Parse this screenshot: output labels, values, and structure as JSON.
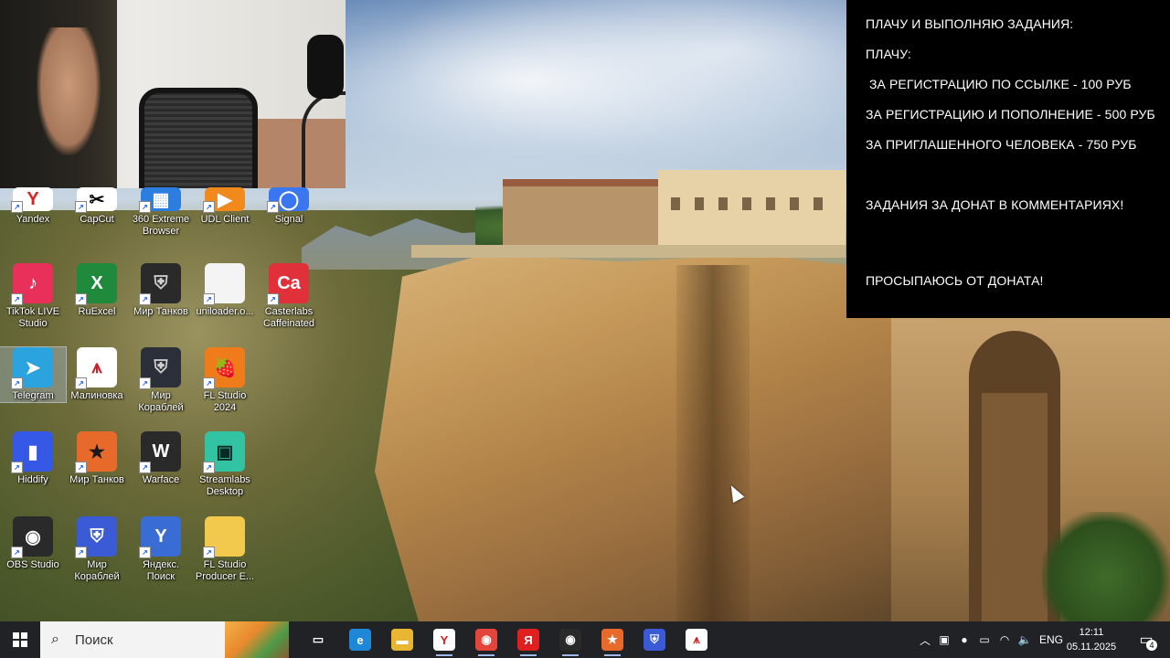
{
  "panel": {
    "lines": [
      "ПЛАЧУ И ВЫПОЛНЯЮ ЗАДАНИЯ:",
      "ПЛАЧУ:",
      " ЗА РЕГИСТРАЦИЮ ПО ССЫЛКЕ - 100 РУБ",
      "ЗА РЕГИСТРАЦИЮ И ПОПОЛНЕНИЕ - 500 РУБ",
      "ЗА ПРИГЛАШЕННОГО ЧЕЛОВЕКА - 750 РУБ",
      "ЗАДАНИЯ ЗА ДОНАТ В КОММЕНТАРИЯХ!",
      "ПРОСЫПАЮСЬ ОТ ДОНАТА!"
    ]
  },
  "desktop": {
    "icons": [
      {
        "label": "Yandex",
        "icon": "yandex-icon",
        "color": "#ffffff",
        "fg": "#e02020",
        "glyph": "Y"
      },
      {
        "label": "CapCut",
        "icon": "capcut-icon",
        "color": "#ffffff",
        "fg": "#000000",
        "glyph": "✂"
      },
      {
        "label": "360 Extreme Browser",
        "icon": "360-browser-icon",
        "color": "#2b7de0",
        "fg": "#ffffff",
        "glyph": "▦"
      },
      {
        "label": "UDL Client",
        "icon": "udl-client-icon",
        "color": "#f08a1c",
        "fg": "#ffffff",
        "glyph": "▶"
      },
      {
        "label": "Signal",
        "icon": "signal-icon",
        "color": "#3a76f0",
        "fg": "#ffffff",
        "glyph": "◯"
      },
      {
        "label": "TikTok LIVE Studio",
        "icon": "tiktok-live-icon",
        "color": "#e8305a",
        "fg": "#ffffff",
        "glyph": "♪"
      },
      {
        "label": "RuExcel",
        "icon": "ruexcel-icon",
        "color": "#1f8a3c",
        "fg": "#ffffff",
        "glyph": "X"
      },
      {
        "label": "Мир Танков",
        "icon": "mir-tankov-icon",
        "color": "#2a2a2a",
        "fg": "#d0d0d0",
        "glyph": "⛨"
      },
      {
        "label": "uniloader.o...",
        "icon": "file-icon",
        "color": "#f4f4f4",
        "fg": "#999999",
        "glyph": ""
      },
      {
        "label": "Casterlabs Caffeinated",
        "icon": "casterlabs-icon",
        "color": "#e0303a",
        "fg": "#ffffff",
        "glyph": "Ca"
      },
      {
        "label": "Telegram",
        "icon": "telegram-icon",
        "color": "#2aa3de",
        "fg": "#ffffff",
        "glyph": "➤"
      },
      {
        "label": "Малиновка",
        "icon": "malinovka-icon",
        "color": "#ffffff",
        "fg": "#c8202f",
        "glyph": "⩚"
      },
      {
        "label": "Мир Кораблей",
        "icon": "mir-korabley-icon",
        "color": "#2b2f3a",
        "fg": "#d0d0d0",
        "glyph": "⛨"
      },
      {
        "label": "FL Studio 2024",
        "icon": "fl-studio-icon",
        "color": "#f07b1a",
        "fg": "#ffffff",
        "glyph": "🍓"
      },
      {
        "label": "Hiddify",
        "icon": "hiddify-icon",
        "color": "#3558e6",
        "fg": "#ffffff",
        "glyph": "▮"
      },
      {
        "label": "Мир Танков",
        "icon": "mir-tankov-lesta-icon",
        "color": "#e86a2a",
        "fg": "#1a1a1a",
        "glyph": "★"
      },
      {
        "label": "Warface",
        "icon": "warface-icon",
        "color": "#2a2a2a",
        "fg": "#ffffff",
        "glyph": "W"
      },
      {
        "label": "Streamlabs Desktop",
        "icon": "streamlabs-icon",
        "color": "#31c3a2",
        "fg": "#0b2a24",
        "glyph": "▣"
      },
      {
        "label": "OBS Studio",
        "icon": "obs-icon",
        "color": "#2a2a2a",
        "fg": "#ffffff",
        "glyph": "◉"
      },
      {
        "label": "Мир Кораблей",
        "icon": "mir-korabley-lesta-icon",
        "color": "#3b5bd6",
        "fg": "#ffffff",
        "glyph": "⛨"
      },
      {
        "label": "Яндекс. Поиск",
        "icon": "yandex-search-icon",
        "color": "#3a6cd6",
        "fg": "#ffffff",
        "glyph": "Y"
      },
      {
        "label": "FL Studio Producer E...",
        "icon": "folder-icon",
        "color": "#f2c94c",
        "fg": "#8a6a18",
        "glyph": ""
      }
    ]
  },
  "taskbar": {
    "search_placeholder": "Поиск",
    "apps": [
      {
        "name": "task-view-icon",
        "glyph": "▭",
        "color": "#202226"
      },
      {
        "name": "edge-icon",
        "glyph": "e",
        "color": "#1e88d6"
      },
      {
        "name": "file-explorer-icon",
        "glyph": "▬",
        "color": "#e8b632"
      },
      {
        "name": "yandex-browser-icon",
        "glyph": "Y",
        "color": "#ffffff"
      },
      {
        "name": "chrome-icon",
        "glyph": "◉",
        "color": "#e3453a"
      },
      {
        "name": "yandex-icon",
        "glyph": "Я",
        "color": "#e02020"
      },
      {
        "name": "obs-recording-icon",
        "glyph": "◉",
        "color": "#2a2a2a"
      },
      {
        "name": "mir-tankov-icon",
        "glyph": "★",
        "color": "#e86a2a"
      },
      {
        "name": "mir-korabley-icon",
        "glyph": "⛨",
        "color": "#3b5bd6"
      },
      {
        "name": "malinovka-icon",
        "glyph": "⩚",
        "color": "#ffffff"
      }
    ],
    "tray": {
      "language": "ENG",
      "time": "12:11",
      "date": "05.11.2025",
      "notifications": "4"
    }
  }
}
